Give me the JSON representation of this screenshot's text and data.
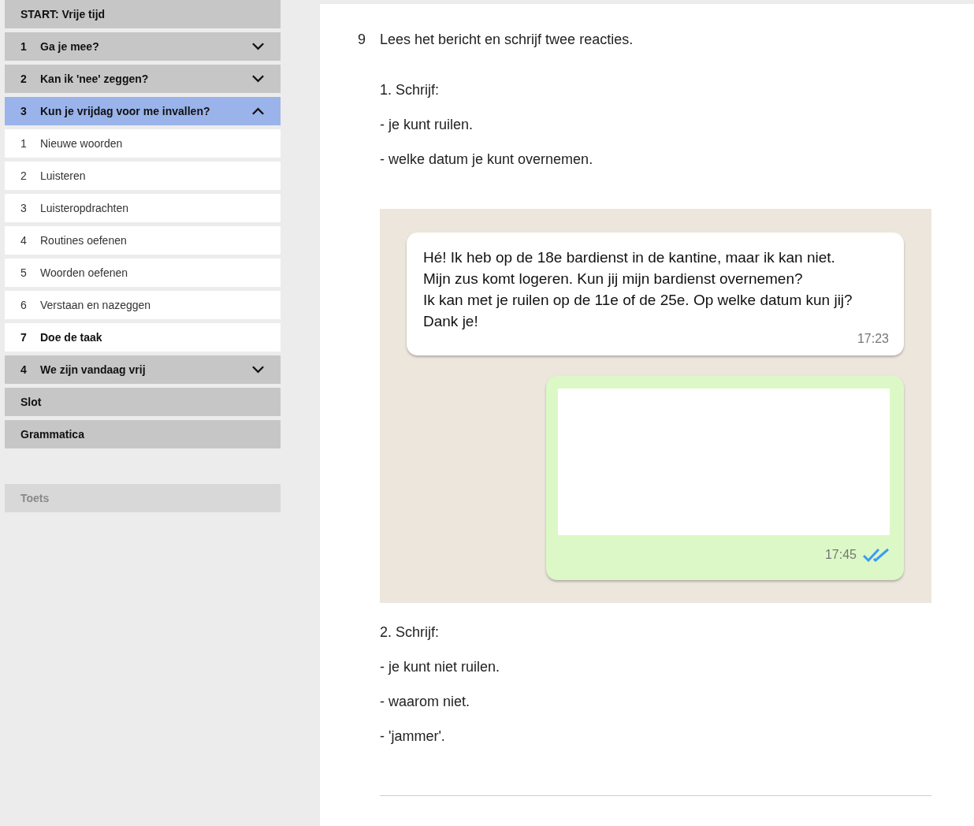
{
  "sidebar": {
    "items": [
      {
        "kind": "header",
        "label": "START: Vrije tijd"
      },
      {
        "kind": "chapter",
        "number": "1",
        "label": "Ga je mee?",
        "expanded": false,
        "selected": false
      },
      {
        "kind": "chapter",
        "number": "2",
        "label": "Kan ik 'nee' zeggen?",
        "expanded": false,
        "selected": false
      },
      {
        "kind": "chapter",
        "number": "3",
        "label": "Kun je vrijdag voor me invallen?",
        "expanded": true,
        "selected": true,
        "children": [
          {
            "kind": "lesson",
            "number": "1",
            "label": "Nieuwe woorden"
          },
          {
            "kind": "lesson",
            "number": "2",
            "label": "Luisteren"
          },
          {
            "kind": "lesson",
            "number": "3",
            "label": "Luisteropdrachten"
          },
          {
            "kind": "lesson",
            "number": "4",
            "label": "Routines oefenen"
          },
          {
            "kind": "lesson",
            "number": "5",
            "label": "Woorden oefenen"
          },
          {
            "kind": "lesson",
            "number": "6",
            "label": "Verstaan en nazeggen"
          },
          {
            "kind": "task",
            "number": "7",
            "label": "Doe de taak"
          }
        ]
      },
      {
        "kind": "chapter",
        "number": "4",
        "label": "We zijn vandaag vrij",
        "expanded": false,
        "selected": false
      },
      {
        "kind": "header",
        "label": "Slot"
      },
      {
        "kind": "header",
        "label": "Grammatica"
      }
    ],
    "test": {
      "label": "Toets",
      "disabled": true
    }
  },
  "exercise": {
    "number": "9",
    "instruction": "Lees het bericht en schrijf twee reacties.",
    "parts": [
      {
        "heading": "1. Schrijf:",
        "bullets": [
          "- je kunt ruilen.",
          "- welke datum je kunt overnemen."
        ]
      }
    ],
    "chat": {
      "incoming": {
        "lines": [
          "Hé! Ik heb op de 18e bardienst in de kantine, maar ik kan niet.",
          "Mijn zus komt logeren. Kun jij mijn bardienst overnemen?",
          "Ik kan met je ruilen op de 11e of de 25e. Op welke datum kun jij?",
          "Dank je!"
        ],
        "time": "17:23"
      },
      "reply": {
        "time": "17:45",
        "read": true
      }
    },
    "parts_after": [
      {
        "heading": "2. Schrijf:",
        "bullets": [
          "- je kunt niet ruilen.",
          "- waarom niet.",
          "- 'jammer'."
        ]
      }
    ]
  }
}
